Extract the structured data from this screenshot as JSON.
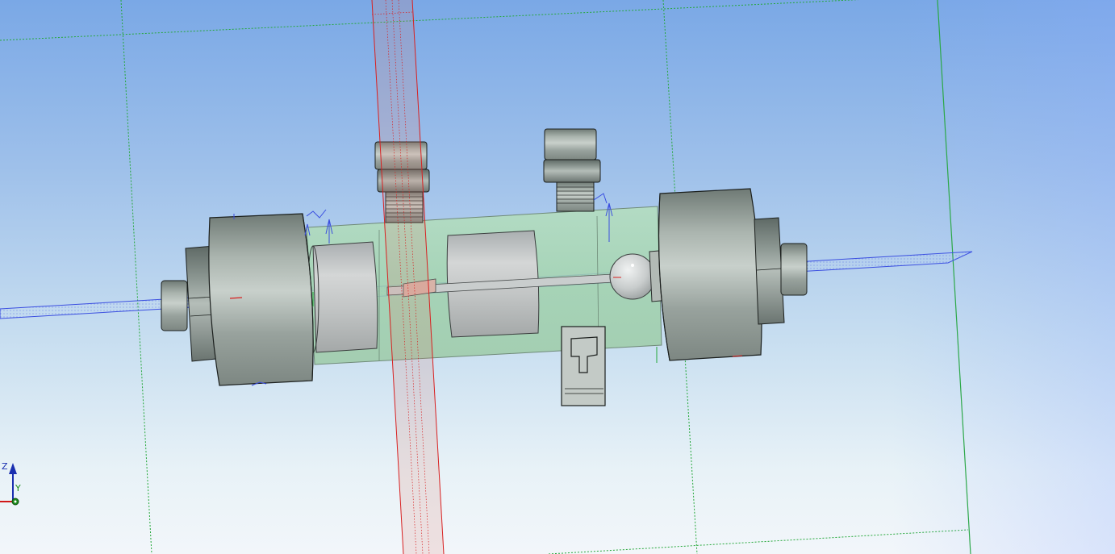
{
  "viewport": {
    "background_top": "#7aa8e6",
    "background_bottom": "#f2f6fa"
  },
  "triad": {
    "z_label": "Z",
    "y_label": "Y",
    "z_color": "#1a2fb0",
    "y_color": "#1c8c1c",
    "x_color": "#d01818"
  },
  "colors": {
    "plane_blue": "#3a4ee0",
    "plane_red": "#d82020",
    "grid_green": "#25a83a",
    "body_fill": "#a8d7b2",
    "metal": "#9ea8a2",
    "edge": "#1b1f1d"
  }
}
